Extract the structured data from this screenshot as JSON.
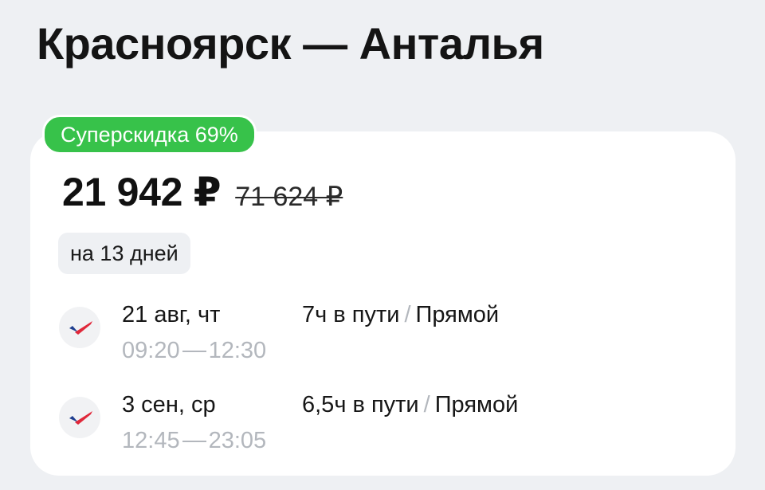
{
  "route": {
    "title": "Красноярск — Анталья"
  },
  "offer": {
    "badge": "Суперскидка 69%",
    "price": "21 942 ₽",
    "old_price": "71 624 ₽",
    "duration_chip": "на 13 дней"
  },
  "segments": [
    {
      "date": "21 авг, чт",
      "depart": "09:20",
      "arrive": "12:30",
      "travel_time": "7ч в пути",
      "type": "Прямой",
      "airline_icon": "airline-logo-icon"
    },
    {
      "date": "3 сен, ср",
      "depart": "12:45",
      "arrive": "23:05",
      "travel_time": "6,5ч в пути",
      "type": "Прямой",
      "airline_icon": "airline-logo-icon"
    }
  ],
  "colors": {
    "badge_green": "#37c24a",
    "background": "#eef0f3",
    "muted_text": "#b3b7bd",
    "airline_red": "#e0283a",
    "airline_blue": "#1f3e8f"
  }
}
